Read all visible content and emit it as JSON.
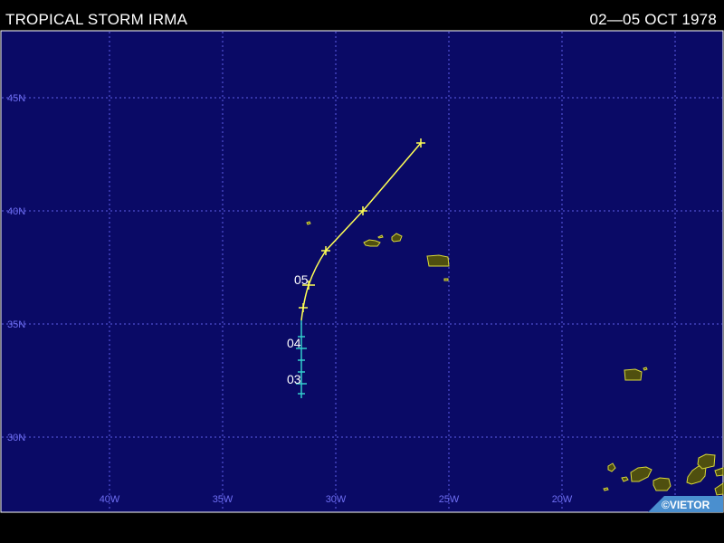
{
  "header": {
    "title": "TROPICAL STORM IRMA",
    "dates": "02—05 OCT 1978"
  },
  "map": {
    "latitudes": [
      "45N",
      "40N",
      "35N",
      "30N"
    ],
    "longitudes": [
      "40W",
      "35W",
      "30W",
      "25W",
      "20W"
    ],
    "colors": {
      "ocean": "#0a0a66",
      "grid": "#5f5fe8",
      "grid_label": "#6e6ef2",
      "land_fill": "#4f4f0f",
      "coast": "#d8d838",
      "track_storm": "#ffff55",
      "track_depression": "#33cccc",
      "day_label": "#ffffff"
    },
    "day_labels": [
      "05",
      "04",
      "03"
    ],
    "watermark": "©VIETOR"
  }
}
